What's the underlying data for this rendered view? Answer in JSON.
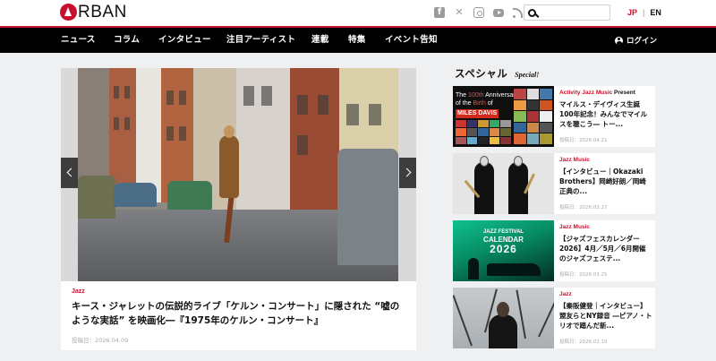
{
  "header": {
    "brand": "RBAN",
    "social_icons": [
      "facebook-icon",
      "x-icon",
      "instagram-icon",
      "youtube-icon",
      "rss-icon"
    ],
    "search": {
      "value": "",
      "placeholder": ""
    },
    "lang": {
      "jp": "JP",
      "separator": "|",
      "en": "EN",
      "active": "JP"
    }
  },
  "nav": {
    "items": [
      "ニュース",
      "コラム",
      "インタビュー",
      "注目アーティスト",
      "連載",
      "特集",
      "イベント告知"
    ],
    "login": "ログイン"
  },
  "feature": {
    "category": "Jazz",
    "title": "キース・ジャレットの伝説的ライブ「ケルン・コンサート」に隠された “嘘のような実話” を映画化―『1975年のケルン・コンサート』",
    "date": "投稿日：2026.04.09"
  },
  "special": {
    "title": "スペシャル",
    "subtitle": "Special!",
    "cards": [
      {
        "meta_red": "Activity Jazz Music",
        "meta_black": " Present",
        "title": "マイルス・デイヴィス生誕100年記念！みんなでマイルスを聴こう― トー...",
        "date": "投稿日：2026.04.21",
        "thumb": {
          "line1_pre": "The ",
          "line1_hl": "100th",
          "line1_post": " Anniversary",
          "line2_pre": "of the ",
          "line2_hl": "Birth",
          "line2_post": " of",
          "name": "MILES DAVIS"
        }
      },
      {
        "meta_red": "Jazz Music",
        "meta_black": "",
        "title": "【インタビュー｜Okazaki Brothers】岡崎好朗／岡崎正典の...",
        "date": "投稿日：2026.03.27"
      },
      {
        "meta_red": "Jazz Music",
        "meta_black": "",
        "title": "【ジャズフェスカレンダー2026】4月／5月／6月開催のジャズフェステ...",
        "date": "投稿日：2026.03.25",
        "thumb": {
          "line1": "JAZZ FESTIVAL",
          "line2": "CALENDAR",
          "line3": "2026"
        }
      },
      {
        "meta_red": "Jazz",
        "meta_black": "",
        "title": "【秦阪健登｜インタビュー】盟友らとNY録音 ―ピアノ・トリオで踏んだ新...",
        "date": "投稿日：2026.02.19"
      }
    ]
  },
  "colors": {
    "accent": "#c8102e",
    "nav_bg": "#000000",
    "page_bg": "#eef0f2"
  }
}
